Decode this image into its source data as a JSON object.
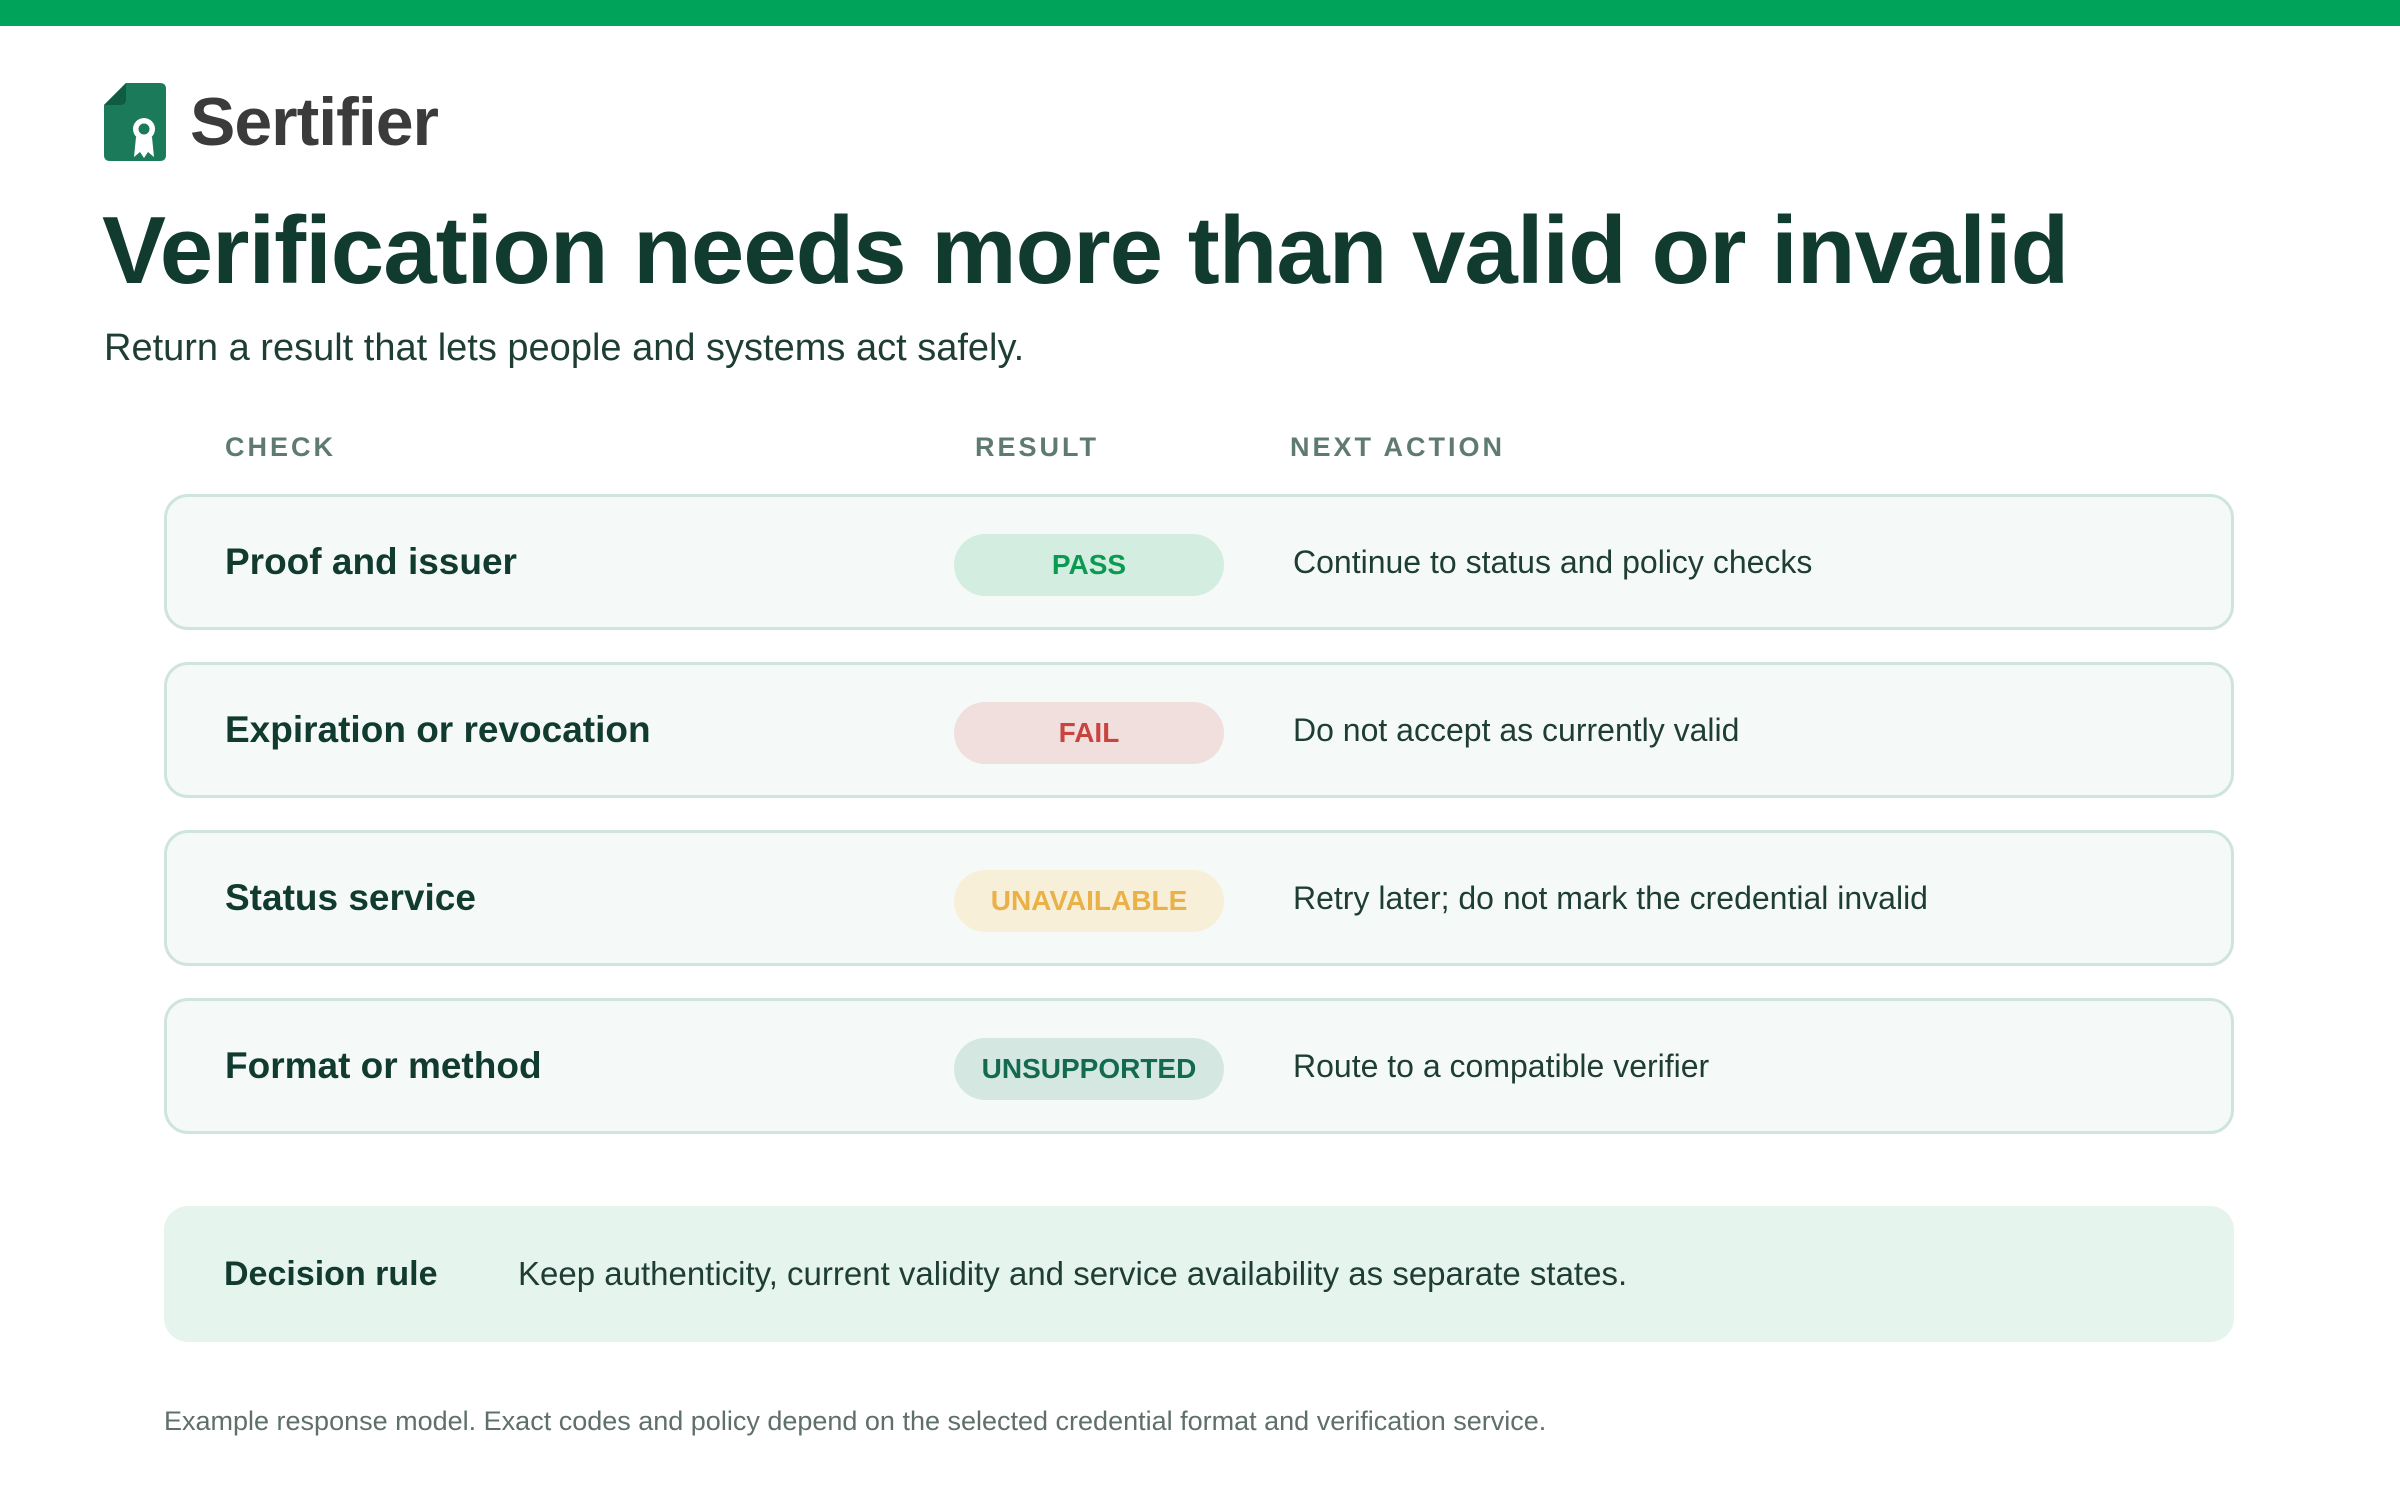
{
  "brand": {
    "name": "Sertifier",
    "icon": "certificate-logo-icon",
    "color": "#1a7a5a"
  },
  "title": "Verification needs more than valid or invalid",
  "subtitle": "Return a result that lets people and systems act safely.",
  "columns": {
    "check": "CHECK",
    "result": "RESULT",
    "next_action": "NEXT ACTION"
  },
  "rows": [
    {
      "check": "Proof and issuer",
      "result": "PASS",
      "next_action": "Continue to status and policy checks",
      "badge_bg": "#d3ede1",
      "badge_color": "#0a9a52"
    },
    {
      "check": "Expiration or revocation",
      "result": "FAIL",
      "next_action": "Do not accept as currently valid",
      "badge_bg": "#f0dfdd",
      "badge_color": "#c8453f"
    },
    {
      "check": "Status service",
      "result": "UNAVAILABLE",
      "next_action": "Retry later; do not mark the credential invalid",
      "badge_bg": "#f8efd9",
      "badge_color": "#e9b148"
    },
    {
      "check": "Format or method",
      "result": "UNSUPPORTED",
      "next_action": "Route to a compatible verifier",
      "badge_bg": "#d4e8e1",
      "badge_color": "#146a50"
    }
  ],
  "decision": {
    "label": "Decision rule",
    "text": "Keep authenticity, current validity and service availability as separate states."
  },
  "footnote": "Example response model. Exact codes and policy depend on the selected credential format and verification service.",
  "colors": {
    "accent_bar": "#00a35a",
    "heading": "#123b30"
  }
}
